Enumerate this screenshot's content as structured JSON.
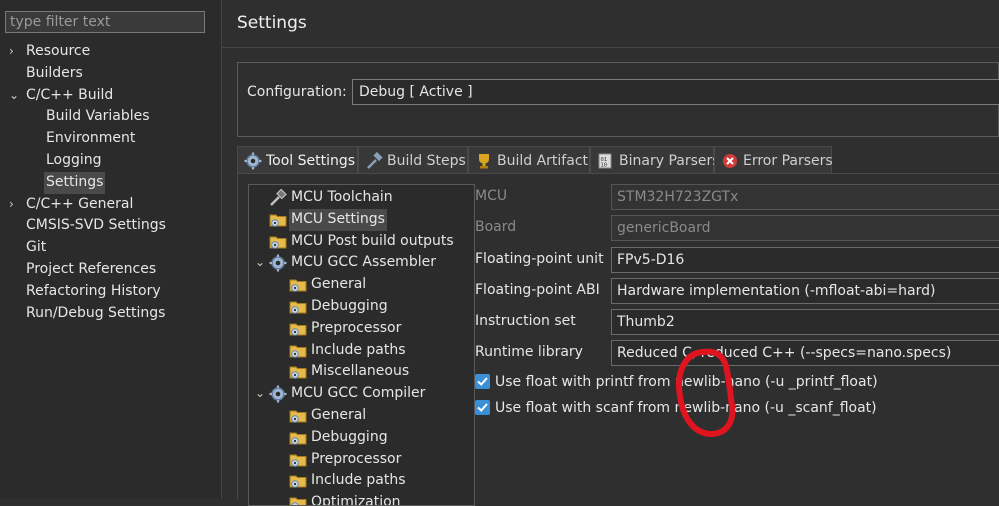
{
  "filter": {
    "placeholder": "type filter text"
  },
  "nav": [
    {
      "label": "Resource",
      "chevron": "›",
      "level": 1
    },
    {
      "label": "Builders",
      "chevron": "",
      "level": 1
    },
    {
      "label": "C/C++ Build",
      "chevron": "⌄",
      "level": 1
    },
    {
      "label": "Build Variables",
      "chevron": "",
      "level": 2
    },
    {
      "label": "Environment",
      "chevron": "",
      "level": 2
    },
    {
      "label": "Logging",
      "chevron": "",
      "level": 2
    },
    {
      "label": "Settings",
      "chevron": "",
      "level": 2,
      "selected": true
    },
    {
      "label": "C/C++ General",
      "chevron": "›",
      "level": 1
    },
    {
      "label": "CMSIS-SVD Settings",
      "chevron": "",
      "level": 1
    },
    {
      "label": "Git",
      "chevron": "",
      "level": 1
    },
    {
      "label": "Project References",
      "chevron": "",
      "level": 1
    },
    {
      "label": "Refactoring History",
      "chevron": "",
      "level": 1
    },
    {
      "label": "Run/Debug Settings",
      "chevron": "",
      "level": 1
    }
  ],
  "header": {
    "title": "Settings"
  },
  "config": {
    "label": "Configuration:",
    "value": "Debug  [ Active ]"
  },
  "tabs": [
    {
      "label": "Tool Settings",
      "icon": "gear-icon",
      "active": true
    },
    {
      "label": "Build Steps",
      "icon": "hammer-icon"
    },
    {
      "label": "Build Artifact",
      "icon": "trophy-icon"
    },
    {
      "label": "Binary Parsers",
      "icon": "binary-icon"
    },
    {
      "label": "Error Parsers",
      "icon": "error-icon"
    }
  ],
  "tree": [
    {
      "label": "MCU Toolchain",
      "icon": "toolchain-icon",
      "indent": 0,
      "chevron": ""
    },
    {
      "label": "MCU Settings",
      "icon": "folder-settings-icon",
      "indent": 0,
      "chevron": "",
      "selected": true
    },
    {
      "label": "MCU Post build outputs",
      "icon": "folder-settings-icon",
      "indent": 0,
      "chevron": ""
    },
    {
      "label": "MCU GCC Assembler",
      "icon": "gear-icon",
      "indent": 0,
      "chevron": "⌄"
    },
    {
      "label": "General",
      "icon": "folder-settings-icon",
      "indent": 1,
      "chevron": ""
    },
    {
      "label": "Debugging",
      "icon": "folder-settings-icon",
      "indent": 1,
      "chevron": ""
    },
    {
      "label": "Preprocessor",
      "icon": "folder-settings-icon",
      "indent": 1,
      "chevron": ""
    },
    {
      "label": "Include paths",
      "icon": "folder-settings-icon",
      "indent": 1,
      "chevron": ""
    },
    {
      "label": "Miscellaneous",
      "icon": "folder-settings-icon",
      "indent": 1,
      "chevron": ""
    },
    {
      "label": "MCU GCC Compiler",
      "icon": "gear-icon",
      "indent": 0,
      "chevron": "⌄"
    },
    {
      "label": "General",
      "icon": "folder-settings-icon",
      "indent": 1,
      "chevron": ""
    },
    {
      "label": "Debugging",
      "icon": "folder-settings-icon",
      "indent": 1,
      "chevron": ""
    },
    {
      "label": "Preprocessor",
      "icon": "folder-settings-icon",
      "indent": 1,
      "chevron": ""
    },
    {
      "label": "Include paths",
      "icon": "folder-settings-icon",
      "indent": 1,
      "chevron": ""
    },
    {
      "label": "Optimization",
      "icon": "folder-settings-icon",
      "indent": 1,
      "chevron": ""
    }
  ],
  "form": {
    "mcu": {
      "label": "MCU",
      "value": "STM32H723ZGTx"
    },
    "board": {
      "label": "Board",
      "value": "genericBoard"
    },
    "fpu": {
      "label": "Floating-point unit",
      "value": "FPv5-D16"
    },
    "fpabi": {
      "label": "Floating-point ABI",
      "value": "Hardware implementation (-mfloat-abi=hard)"
    },
    "iset": {
      "label": "Instruction set",
      "value": "Thumb2"
    },
    "runtime": {
      "label": "Runtime library",
      "value": "Reduced C, reduced C++ (--specs=nano.specs)"
    },
    "printf": {
      "label": "Use float with printf from newlib-nano (-u _printf_float)",
      "checked": true
    },
    "scanf": {
      "label": "Use float with scanf from newlib-nano (-u _scanf_float)",
      "checked": true
    }
  },
  "colors": {
    "accent": "#3a8fd6",
    "annotation": "#e0141e"
  }
}
